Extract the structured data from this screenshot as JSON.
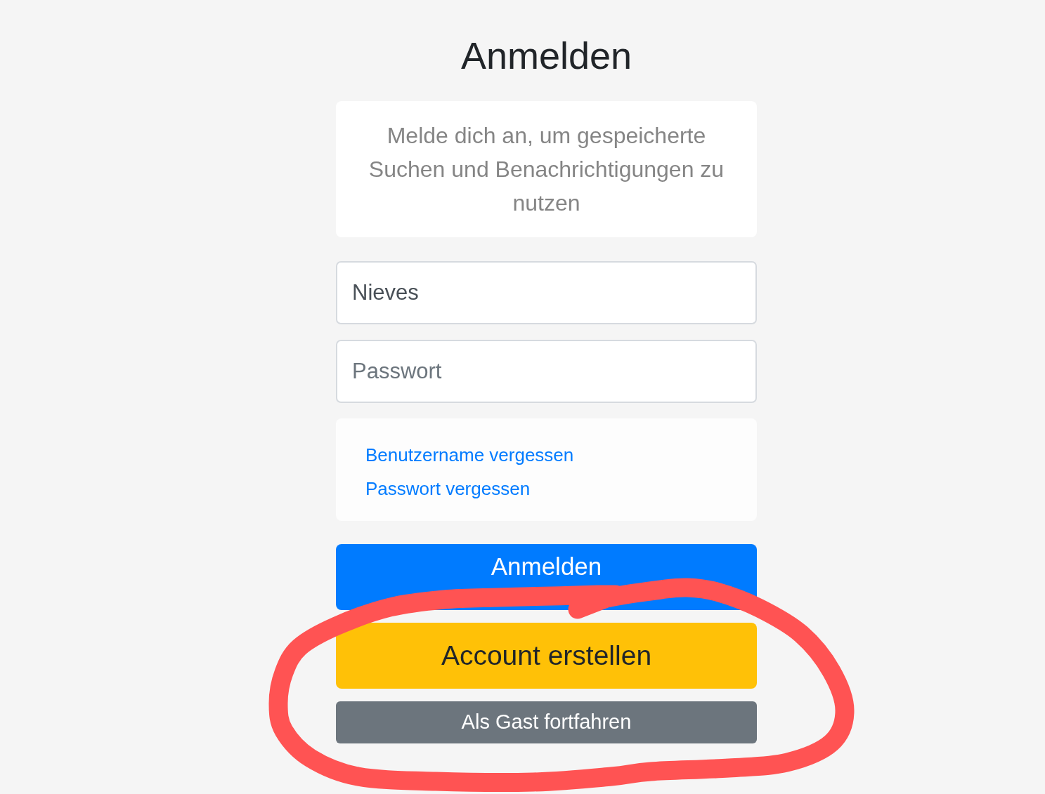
{
  "page": {
    "title": "Anmelden"
  },
  "info_card": {
    "text": "Melde dich an, um gespeicherte Suchen und Benachrichtigungen zu nutzen"
  },
  "fields": [
    {
      "kind": "text",
      "value": "Nieves"
    },
    {
      "kind": "password",
      "placeholder": "Passwort"
    }
  ],
  "links": [
    "Benutzername vergessen",
    "Passwort vergessen"
  ],
  "buttons": [
    {
      "kind": "primary",
      "label": "Anmelden"
    },
    {
      "kind": "warning",
      "label": "Account erstellen"
    },
    {
      "kind": "secondary",
      "label": "Als Gast fortfahren"
    }
  ],
  "annotation": {
    "kind": "freehand-loop"
  }
}
